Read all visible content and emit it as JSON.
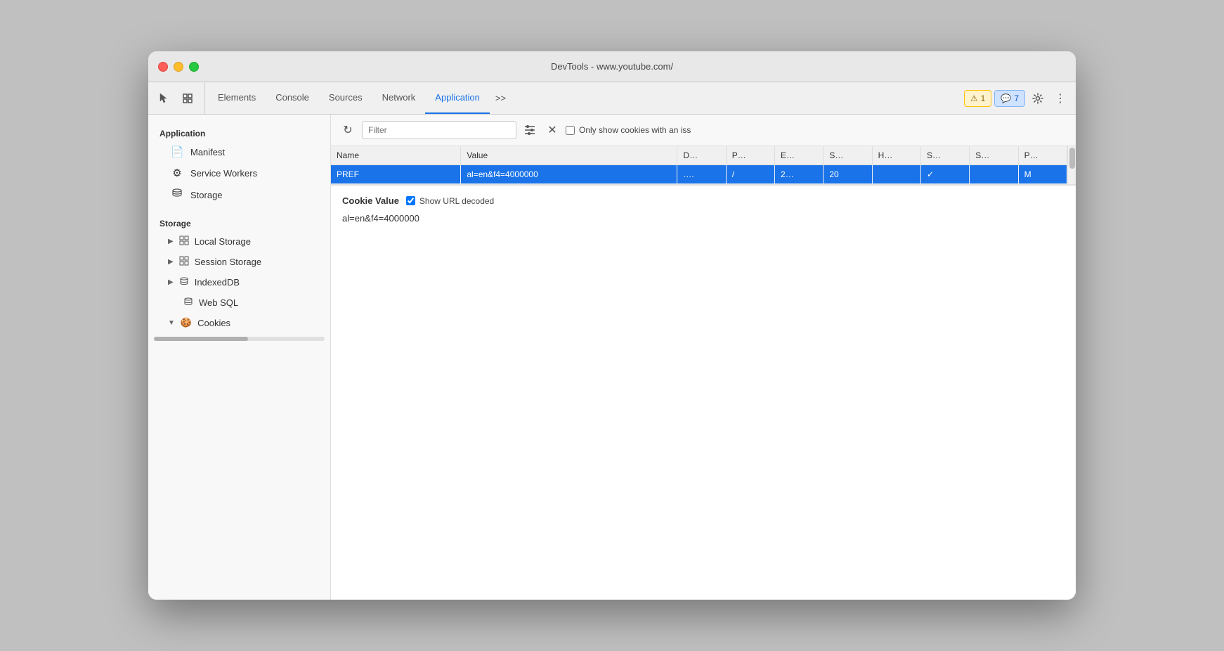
{
  "window": {
    "title": "DevTools - www.youtube.com/"
  },
  "tabs": [
    {
      "id": "elements",
      "label": "Elements",
      "active": false
    },
    {
      "id": "console",
      "label": "Console",
      "active": false
    },
    {
      "id": "sources",
      "label": "Sources",
      "active": false
    },
    {
      "id": "network",
      "label": "Network",
      "active": false
    },
    {
      "id": "application",
      "label": "Application",
      "active": true
    }
  ],
  "tab_overflow_label": ">>",
  "badge_warn": {
    "icon": "⚠",
    "count": "1"
  },
  "badge_info": {
    "icon": "💬",
    "count": "7"
  },
  "sidebar": {
    "app_section": "Application",
    "items": [
      {
        "id": "manifest",
        "label": "Manifest",
        "icon": "📄"
      },
      {
        "id": "service-workers",
        "label": "Service Workers",
        "icon": "⚙"
      },
      {
        "id": "storage-app",
        "label": "Storage",
        "icon": "🗄"
      }
    ],
    "storage_section": "Storage",
    "storage_items": [
      {
        "id": "local-storage",
        "label": "Local Storage",
        "expanded": false
      },
      {
        "id": "session-storage",
        "label": "Session Storage",
        "expanded": false
      },
      {
        "id": "indexeddb",
        "label": "IndexedDB",
        "expanded": false
      },
      {
        "id": "web-sql",
        "label": "Web SQL",
        "expanded": false,
        "no_arrow": true
      },
      {
        "id": "cookies",
        "label": "Cookies",
        "expanded": true
      }
    ]
  },
  "toolbar": {
    "refresh_icon": "↻",
    "filter_placeholder": "Filter",
    "filter_cols_icon": "≡",
    "clear_icon": "✕",
    "checkbox_label": "Only show cookies with an iss"
  },
  "table": {
    "columns": [
      "Name",
      "Value",
      "D…",
      "P…",
      "E…",
      "S…",
      "H…",
      "S…",
      "S…",
      "P…"
    ],
    "rows": [
      {
        "name": "PREF",
        "value": "al=en&f4=4000000",
        "domain": "….",
        "path": "/",
        "expires": "2…",
        "size": "20",
        "http_only": "",
        "secure": "✓",
        "same_site": "",
        "priority": "M"
      }
    ]
  },
  "cookie_value": {
    "label": "Cookie Value",
    "show_url_decoded": true,
    "checkbox_label": "Show URL decoded",
    "value": "al=en&f4=4000000"
  },
  "colors": {
    "selected_row_bg": "#1a73e8",
    "active_tab_color": "#1a73e8"
  }
}
